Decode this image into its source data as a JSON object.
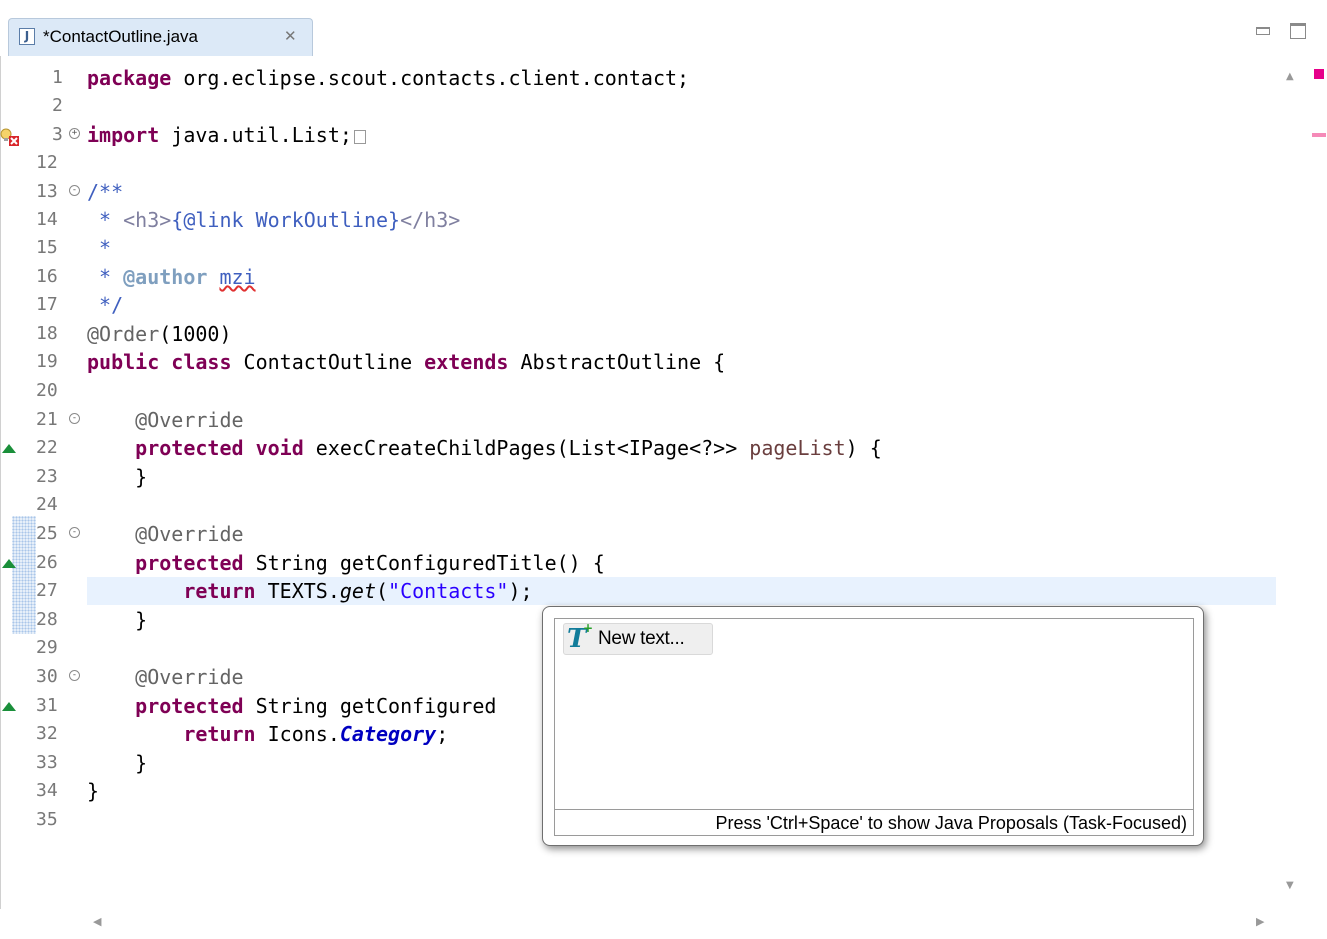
{
  "tab": {
    "title": "*ContactOutline.java",
    "icon": "java-file-icon",
    "close_glyph": "✕"
  },
  "window_controls": [
    "minimize-icon",
    "maximize-icon"
  ],
  "editor": {
    "lines": [
      {
        "n": "1",
        "fold": ""
      },
      {
        "n": "2",
        "fold": ""
      },
      {
        "n": "3",
        "fold": "+"
      },
      {
        "n": "12",
        "fold": ""
      },
      {
        "n": "13",
        "fold": "-"
      },
      {
        "n": "14",
        "fold": ""
      },
      {
        "n": "15",
        "fold": ""
      },
      {
        "n": "16",
        "fold": ""
      },
      {
        "n": "17",
        "fold": ""
      },
      {
        "n": "18",
        "fold": ""
      },
      {
        "n": "19",
        "fold": ""
      },
      {
        "n": "20",
        "fold": ""
      },
      {
        "n": "21",
        "fold": "-"
      },
      {
        "n": "22",
        "fold": ""
      },
      {
        "n": "23",
        "fold": ""
      },
      {
        "n": "24",
        "fold": ""
      },
      {
        "n": "25",
        "fold": "-"
      },
      {
        "n": "26",
        "fold": ""
      },
      {
        "n": "27",
        "fold": ""
      },
      {
        "n": "28",
        "fold": ""
      },
      {
        "n": "29",
        "fold": ""
      },
      {
        "n": "30",
        "fold": "-"
      },
      {
        "n": "31",
        "fold": ""
      },
      {
        "n": "32",
        "fold": ""
      },
      {
        "n": "33",
        "fold": ""
      },
      {
        "n": "34",
        "fold": ""
      },
      {
        "n": "35",
        "fold": ""
      }
    ],
    "code": {
      "l1_kw": "package",
      "l1_rest": " org.eclipse.scout.contacts.client.contact;",
      "l3_kw": "import",
      "l3_rest": " java.util.List;",
      "l13": "/**",
      "l14_star": " * ",
      "l14_open": "<h3>",
      "l14_link": "{@link WorkOutline}",
      "l14_close": "</h3>",
      "l15": " *",
      "l16_star": " * ",
      "l16_tag": "@author",
      "l16_sp": " ",
      "l16_name": "mzi",
      "l17": " */",
      "l18_an": "@Order",
      "l18_rest": "(1000)",
      "l19_kw1": "public",
      "l19_sp1": " ",
      "l19_kw2": "class",
      "l19_mid": " ContactOutline ",
      "l19_kw3": "extends",
      "l19_rest": " AbstractOutline {",
      "l21_an": "    @Override",
      "l22_ind": "    ",
      "l22_kw1": "protected",
      "l22_sp": " ",
      "l22_kw2": "void",
      "l22_mid": " execCreateChildPages(List<IPage<?>> ",
      "l22_param": "pageList",
      "l22_rest": ") {",
      "l23": "    }",
      "l25_an": "    @Override",
      "l26_ind": "    ",
      "l26_kw": "protected",
      "l26_rest": " String getConfiguredTitle() {",
      "l27_ind": "        ",
      "l27_kw": "return",
      "l27_mid": " TEXTS.",
      "l27_get": "get",
      "l27_open": "(",
      "l27_str": "\"Contacts\"",
      "l27_rest": ");",
      "l28": "    }",
      "l30_an": "    @Override",
      "l31_ind": "    ",
      "l31_kw": "protected",
      "l31_rest": " String getConfigured",
      "l32_ind": "        ",
      "l32_kw": "return",
      "l32_mid": " Icons.",
      "l32_fld": "Category",
      "l32_rest": ";",
      "l33": "    }",
      "l34": "}"
    }
  },
  "popup": {
    "item_label": "New text...",
    "item_icon": "new-text-icon",
    "status": "Press 'Ctrl+Space' to show Java Proposals (Task-Focused)"
  },
  "colors": {
    "keyword": "#7f0055",
    "string": "#2a00ff",
    "javadoc": "#3f5fbf",
    "current_line": "#e8f2fe",
    "tab_active": "#dce9f7",
    "override_marker": "#1a8f3a",
    "error_marker": "#e6008a"
  }
}
